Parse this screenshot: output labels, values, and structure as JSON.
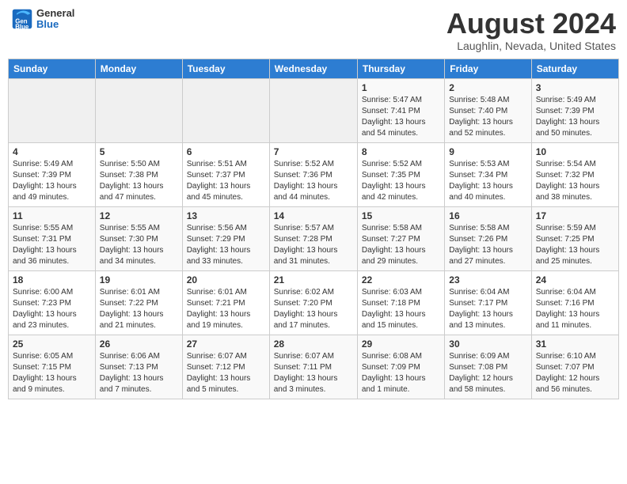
{
  "header": {
    "logo": {
      "general": "General",
      "blue": "Blue"
    },
    "title": "August 2024",
    "location": "Laughlin, Nevada, United States"
  },
  "calendar": {
    "days_of_week": [
      "Sunday",
      "Monday",
      "Tuesday",
      "Wednesday",
      "Thursday",
      "Friday",
      "Saturday"
    ],
    "weeks": [
      [
        {
          "day": "",
          "info": ""
        },
        {
          "day": "",
          "info": ""
        },
        {
          "day": "",
          "info": ""
        },
        {
          "day": "",
          "info": ""
        },
        {
          "day": "1",
          "info": "Sunrise: 5:47 AM\nSunset: 7:41 PM\nDaylight: 13 hours\nand 54 minutes."
        },
        {
          "day": "2",
          "info": "Sunrise: 5:48 AM\nSunset: 7:40 PM\nDaylight: 13 hours\nand 52 minutes."
        },
        {
          "day": "3",
          "info": "Sunrise: 5:49 AM\nSunset: 7:39 PM\nDaylight: 13 hours\nand 50 minutes."
        }
      ],
      [
        {
          "day": "4",
          "info": "Sunrise: 5:49 AM\nSunset: 7:39 PM\nDaylight: 13 hours\nand 49 minutes."
        },
        {
          "day": "5",
          "info": "Sunrise: 5:50 AM\nSunset: 7:38 PM\nDaylight: 13 hours\nand 47 minutes."
        },
        {
          "day": "6",
          "info": "Sunrise: 5:51 AM\nSunset: 7:37 PM\nDaylight: 13 hours\nand 45 minutes."
        },
        {
          "day": "7",
          "info": "Sunrise: 5:52 AM\nSunset: 7:36 PM\nDaylight: 13 hours\nand 44 minutes."
        },
        {
          "day": "8",
          "info": "Sunrise: 5:52 AM\nSunset: 7:35 PM\nDaylight: 13 hours\nand 42 minutes."
        },
        {
          "day": "9",
          "info": "Sunrise: 5:53 AM\nSunset: 7:34 PM\nDaylight: 13 hours\nand 40 minutes."
        },
        {
          "day": "10",
          "info": "Sunrise: 5:54 AM\nSunset: 7:32 PM\nDaylight: 13 hours\nand 38 minutes."
        }
      ],
      [
        {
          "day": "11",
          "info": "Sunrise: 5:55 AM\nSunset: 7:31 PM\nDaylight: 13 hours\nand 36 minutes."
        },
        {
          "day": "12",
          "info": "Sunrise: 5:55 AM\nSunset: 7:30 PM\nDaylight: 13 hours\nand 34 minutes."
        },
        {
          "day": "13",
          "info": "Sunrise: 5:56 AM\nSunset: 7:29 PM\nDaylight: 13 hours\nand 33 minutes."
        },
        {
          "day": "14",
          "info": "Sunrise: 5:57 AM\nSunset: 7:28 PM\nDaylight: 13 hours\nand 31 minutes."
        },
        {
          "day": "15",
          "info": "Sunrise: 5:58 AM\nSunset: 7:27 PM\nDaylight: 13 hours\nand 29 minutes."
        },
        {
          "day": "16",
          "info": "Sunrise: 5:58 AM\nSunset: 7:26 PM\nDaylight: 13 hours\nand 27 minutes."
        },
        {
          "day": "17",
          "info": "Sunrise: 5:59 AM\nSunset: 7:25 PM\nDaylight: 13 hours\nand 25 minutes."
        }
      ],
      [
        {
          "day": "18",
          "info": "Sunrise: 6:00 AM\nSunset: 7:23 PM\nDaylight: 13 hours\nand 23 minutes."
        },
        {
          "day": "19",
          "info": "Sunrise: 6:01 AM\nSunset: 7:22 PM\nDaylight: 13 hours\nand 21 minutes."
        },
        {
          "day": "20",
          "info": "Sunrise: 6:01 AM\nSunset: 7:21 PM\nDaylight: 13 hours\nand 19 minutes."
        },
        {
          "day": "21",
          "info": "Sunrise: 6:02 AM\nSunset: 7:20 PM\nDaylight: 13 hours\nand 17 minutes."
        },
        {
          "day": "22",
          "info": "Sunrise: 6:03 AM\nSunset: 7:18 PM\nDaylight: 13 hours\nand 15 minutes."
        },
        {
          "day": "23",
          "info": "Sunrise: 6:04 AM\nSunset: 7:17 PM\nDaylight: 13 hours\nand 13 minutes."
        },
        {
          "day": "24",
          "info": "Sunrise: 6:04 AM\nSunset: 7:16 PM\nDaylight: 13 hours\nand 11 minutes."
        }
      ],
      [
        {
          "day": "25",
          "info": "Sunrise: 6:05 AM\nSunset: 7:15 PM\nDaylight: 13 hours\nand 9 minutes."
        },
        {
          "day": "26",
          "info": "Sunrise: 6:06 AM\nSunset: 7:13 PM\nDaylight: 13 hours\nand 7 minutes."
        },
        {
          "day": "27",
          "info": "Sunrise: 6:07 AM\nSunset: 7:12 PM\nDaylight: 13 hours\nand 5 minutes."
        },
        {
          "day": "28",
          "info": "Sunrise: 6:07 AM\nSunset: 7:11 PM\nDaylight: 13 hours\nand 3 minutes."
        },
        {
          "day": "29",
          "info": "Sunrise: 6:08 AM\nSunset: 7:09 PM\nDaylight: 13 hours\nand 1 minute."
        },
        {
          "day": "30",
          "info": "Sunrise: 6:09 AM\nSunset: 7:08 PM\nDaylight: 12 hours\nand 58 minutes."
        },
        {
          "day": "31",
          "info": "Sunrise: 6:10 AM\nSunset: 7:07 PM\nDaylight: 12 hours\nand 56 minutes."
        }
      ]
    ]
  }
}
